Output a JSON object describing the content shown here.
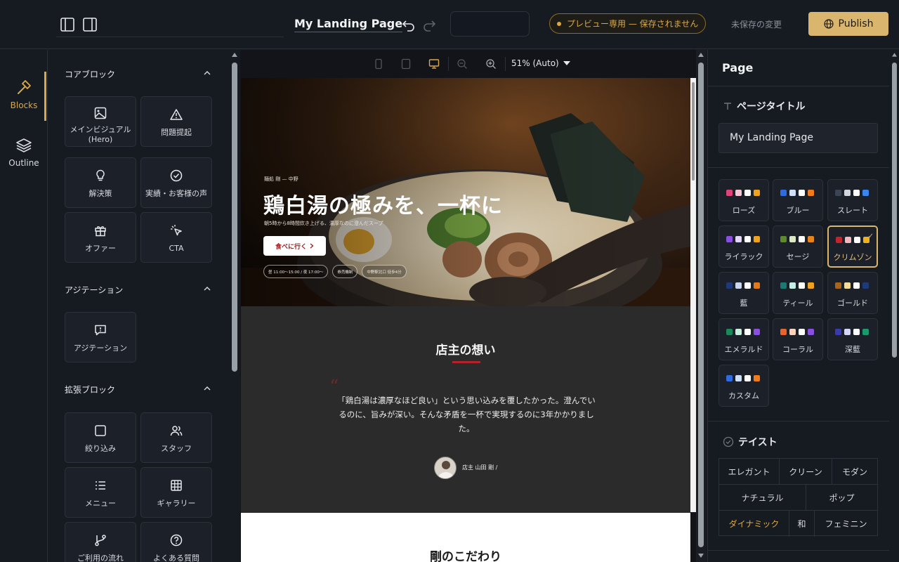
{
  "topbar": {
    "page_name": "My Landing Page",
    "preview_notice": "プレビュー専用 — 保存されません",
    "unsaved_label": "未保存の変更",
    "publish_label": "Publish"
  },
  "rail": {
    "blocks_label": "Blocks",
    "outline_label": "Outline"
  },
  "blocks_panel": {
    "sections": [
      {
        "title": "コアブロック",
        "items": [
          "メインビジュアル\n(Hero)",
          "問題提起",
          "解決策",
          "実績・お客様の声",
          "オファー",
          "CTA"
        ]
      },
      {
        "title": "アジテーション",
        "items": [
          "アジテーション"
        ]
      },
      {
        "title": "拡張ブロック",
        "items": [
          "絞り込み",
          "スタッフ",
          "メニュー",
          "ギャラリー",
          "ご利用の流れ",
          "よくある質問"
        ]
      }
    ]
  },
  "canvas": {
    "zoom_label": "51% (Auto)",
    "hero": {
      "eyebrow": "麺処 剛 — 中野",
      "title": "鶏白湯の極みを、一杯に",
      "subtitle": "朝5時から8時間炊き上げる、濃厚なのに澄んだスープ",
      "cta": "食べに行く",
      "chips": [
        "昼 11:00〜15:00 / 夜 17:00〜",
        "券売機制",
        "中野駅北口 徒歩4分"
      ]
    },
    "owner": {
      "title": "店主の想い",
      "quote": "「鶏白湯は濃厚なほど良い」という思い込みを覆したかった。澄んでいるのに、旨みが深い。そんな矛盾を一杯で実現するのに3年かかりました。",
      "name": "店主 山田 剛 /"
    },
    "next_section_title": "剛のこだわり"
  },
  "right_panel": {
    "title": "Page",
    "page_title_label": "ページタイトル",
    "page_title_value": "My Landing Page",
    "palettes": [
      {
        "name": "ローズ",
        "colors": [
          "#e0427a",
          "#f6c6d4",
          "#ffffff",
          "#f0a21c"
        ],
        "selected": false
      },
      {
        "name": "ブルー",
        "colors": [
          "#2f6ae0",
          "#cfe0fb",
          "#ffffff",
          "#f07a1c"
        ],
        "selected": false
      },
      {
        "name": "スレート",
        "colors": [
          "#3a4454",
          "#cfd6e0",
          "#ffffff",
          "#3a86f0"
        ],
        "selected": false
      },
      {
        "name": "ライラック",
        "colors": [
          "#8a4ee0",
          "#e4d6fa",
          "#ffffff",
          "#f0a21c"
        ],
        "selected": false
      },
      {
        "name": "セージ",
        "colors": [
          "#5f8a2c",
          "#dbe8c6",
          "#ffffff",
          "#e8841c"
        ],
        "selected": false
      },
      {
        "name": "クリムゾン",
        "colors": [
          "#c0242c",
          "#f4b8bc",
          "#ffffff",
          "#f0b21c"
        ],
        "selected": true
      },
      {
        "name": "藍",
        "colors": [
          "#1f3a78",
          "#c8d6f0",
          "#ffffff",
          "#e07a1c"
        ],
        "selected": false
      },
      {
        "name": "ティール",
        "colors": [
          "#1a7a72",
          "#c6ece8",
          "#ffffff",
          "#f0a21c"
        ],
        "selected": false
      },
      {
        "name": "ゴールド",
        "colors": [
          "#a8641c",
          "#f6dc9a",
          "#ffffff",
          "#1f3a78"
        ],
        "selected": false
      },
      {
        "name": "エメラルド",
        "colors": [
          "#1a8a5a",
          "#c8f0dc",
          "#ffffff",
          "#8a4ee0"
        ],
        "selected": false
      },
      {
        "name": "コーラル",
        "colors": [
          "#e8642c",
          "#fbd2bc",
          "#ffffff",
          "#8a4ee0"
        ],
        "selected": false
      },
      {
        "name": "深藍",
        "colors": [
          "#3a3ab0",
          "#d4d6fa",
          "#ffffff",
          "#1a9a6a"
        ],
        "selected": false
      },
      {
        "name": "カスタム",
        "colors": [
          "#2f6ae0",
          "#cfe0fb",
          "#ffffff",
          "#f07a1c"
        ],
        "selected": false
      }
    ],
    "taste_label": "テイスト",
    "tastes": [
      {
        "label": "エレガント",
        "active": false
      },
      {
        "label": "クリーン",
        "active": false
      },
      {
        "label": "モダン",
        "active": false
      },
      {
        "label": "ナチュラル",
        "active": false
      },
      {
        "label": "ポップ",
        "active": false
      },
      {
        "label": "ダイナミック",
        "active": true
      },
      {
        "label": "和",
        "active": false
      },
      {
        "label": "フェミニン",
        "active": false
      }
    ]
  }
}
